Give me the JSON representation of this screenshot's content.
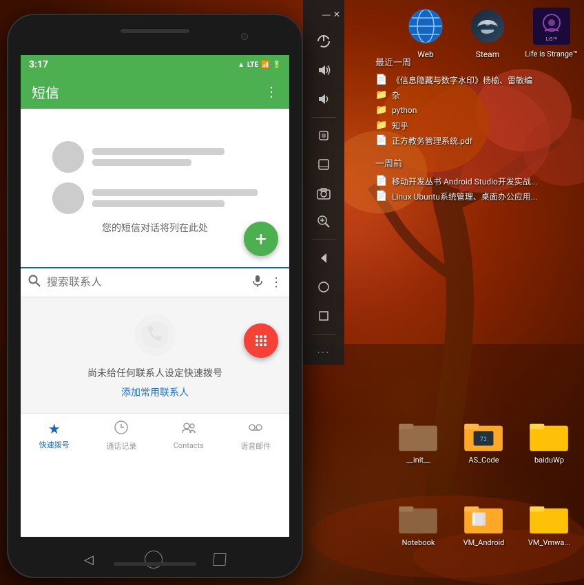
{
  "desktop": {
    "background_color": "#8B2500",
    "top_icons": [
      {
        "id": "web",
        "label": "Web",
        "type": "globe"
      },
      {
        "id": "steam",
        "label": "Steam",
        "type": "steam"
      },
      {
        "id": "life_is_strange",
        "label": "Life is Strange™",
        "type": "game"
      }
    ]
  },
  "side_panel": {
    "buttons": [
      {
        "id": "power",
        "icon": "⏻",
        "label": "power"
      },
      {
        "id": "volume_up",
        "icon": "🔊",
        "label": "volume-up"
      },
      {
        "id": "volume_down",
        "icon": "🔉",
        "label": "volume-down"
      },
      {
        "id": "rotate",
        "icon": "◈",
        "label": "rotate"
      },
      {
        "id": "eraser",
        "icon": "✏",
        "label": "eraser"
      },
      {
        "id": "camera",
        "icon": "📷",
        "label": "camera"
      },
      {
        "id": "zoom",
        "icon": "🔍",
        "label": "zoom"
      },
      {
        "id": "back_arrow",
        "icon": "◁",
        "label": "back"
      },
      {
        "id": "circle",
        "icon": "○",
        "label": "circle"
      },
      {
        "id": "square",
        "icon": "□",
        "label": "square"
      },
      {
        "id": "more",
        "icon": "···",
        "label": "more"
      }
    ]
  },
  "recent_files": {
    "section1_title": "最近一周",
    "section1_items": [
      {
        "name": "《信息隐藏与数字水印》杨榆、雷敏编",
        "type": "pdf"
      },
      {
        "name": "杂",
        "type": "folder_yellow"
      },
      {
        "name": "python",
        "type": "folder_yellow"
      },
      {
        "name": "知乎",
        "type": "folder_yellow"
      },
      {
        "name": "正方教务管理系统.pdf",
        "type": "pdf"
      }
    ],
    "section2_title": "一周前",
    "section2_items": [
      {
        "name": "移动开发丛书 Android Studio开发实战...",
        "type": "pdf"
      },
      {
        "name": "Linux Ubuntu系统管理、桌面办公应用...",
        "type": "pdf"
      }
    ]
  },
  "desktop_folders": {
    "row1": [
      {
        "id": "init",
        "label": "__init__",
        "type": "folder_brown"
      },
      {
        "id": "as_code",
        "label": "AS_Code",
        "type": "folder_special"
      },
      {
        "id": "baiduWp",
        "label": "baiduWp",
        "type": "folder_yellow"
      }
    ],
    "row2": [
      {
        "id": "notebook",
        "label": "Notebook",
        "type": "folder_brown"
      },
      {
        "id": "vm_android",
        "label": "VM_Android",
        "type": "folder_special2"
      },
      {
        "id": "vm_vmwa",
        "label": "VM_Vmwa...",
        "type": "folder_yellow"
      }
    ]
  },
  "phone": {
    "status_bar": {
      "time": "3:17",
      "indicators": [
        "📶",
        "🔋"
      ],
      "lte": "LTE",
      "signal_bars": "▋▋▋"
    },
    "app": {
      "title": "短信",
      "empty_text": "您的短信对话将列在此处"
    },
    "search": {
      "placeholder": "搜索联系人"
    },
    "quick_dial": {
      "empty_text": "尚未给任何联系人设定快速拨号",
      "add_link": "添加常用联系人"
    },
    "bottom_nav": [
      {
        "id": "quick_dial",
        "label": "快速拨号",
        "active": true,
        "icon": "★"
      },
      {
        "id": "call_log",
        "label": "通话记录",
        "active": false,
        "icon": "🕐"
      },
      {
        "id": "contacts",
        "label": "Contacts",
        "active": false,
        "icon": "👥"
      },
      {
        "id": "voicemail",
        "label": "语音邮件",
        "active": false,
        "icon": "📢"
      }
    ],
    "hw_buttons": {
      "back": "◁",
      "home": "○",
      "recents": "□"
    }
  }
}
